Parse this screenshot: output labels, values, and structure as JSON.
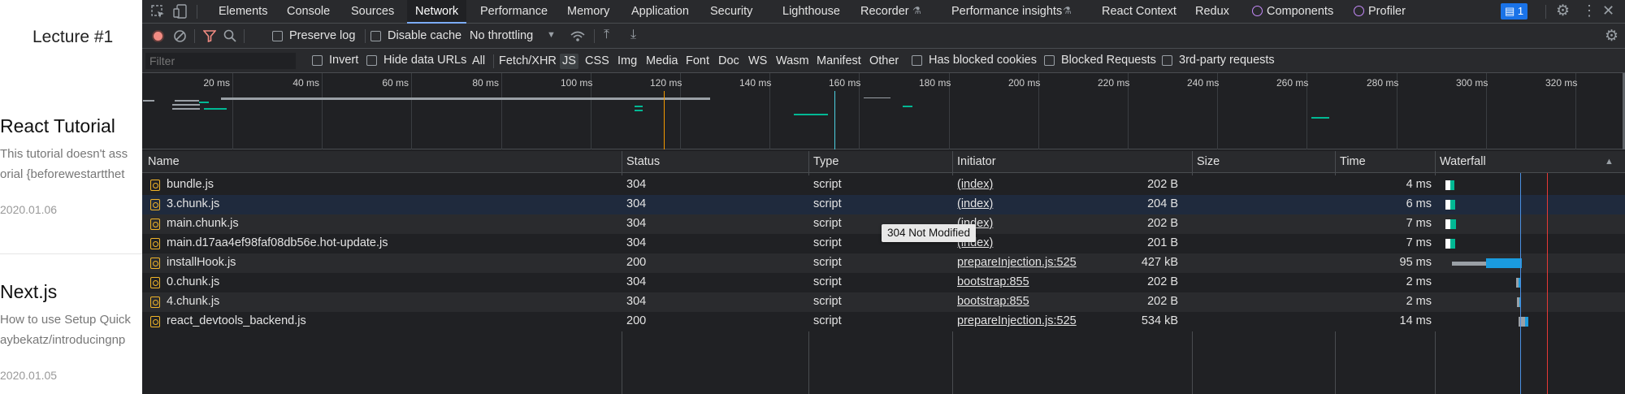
{
  "page": {
    "lecture": "Lecture #1",
    "posts": [
      {
        "title": "React Tutorial",
        "desc1": "This tutorial doesn't ass",
        "desc2": "orial {beforewestartthet",
        "date": "2020.01.06"
      },
      {
        "title": "Next.js",
        "desc1": "How to use Setup Quick",
        "desc2": "aybekatz/introducingnp",
        "date": "2020.01.05"
      }
    ]
  },
  "devtools": {
    "tabs": [
      "Elements",
      "Console",
      "Sources",
      "Network",
      "Performance",
      "Memory",
      "Application",
      "Security",
      "Lighthouse",
      "Recorder",
      "Performance insights",
      "React Context",
      "Redux",
      "Components",
      "Profiler"
    ],
    "active_tab": "Network",
    "issues_badge": "1",
    "toolbar": {
      "preserve_log": "Preserve log",
      "disable_cache": "Disable cache",
      "throttling": "No throttling"
    },
    "filterbar": {
      "placeholder": "Filter",
      "invert": "Invert",
      "hide_data_urls": "Hide data URLs",
      "types": [
        "All",
        "Fetch/XHR",
        "JS",
        "CSS",
        "Img",
        "Media",
        "Font",
        "Doc",
        "WS",
        "Wasm",
        "Manifest",
        "Other"
      ],
      "selected_type": "JS",
      "has_blocked_cookies": "Has blocked cookies",
      "blocked_requests": "Blocked Requests",
      "third_party": "3rd-party requests"
    },
    "timeline_ticks": [
      "20 ms",
      "40 ms",
      "60 ms",
      "80 ms",
      "100 ms",
      "120 ms",
      "140 ms",
      "160 ms",
      "180 ms",
      "200 ms",
      "220 ms",
      "240 ms",
      "260 ms",
      "280 ms",
      "300 ms",
      "320 ms"
    ],
    "columns": [
      "Name",
      "Status",
      "Type",
      "Initiator",
      "Size",
      "Time",
      "Waterfall"
    ],
    "rows": [
      {
        "name": "bundle.js",
        "status": "304",
        "type": "script",
        "initiator": "(index)",
        "size": "202 B",
        "time": "4 ms"
      },
      {
        "name": "3.chunk.js",
        "status": "304",
        "type": "script",
        "initiator": "(index)",
        "size": "204 B",
        "time": "6 ms"
      },
      {
        "name": "main.chunk.js",
        "status": "304",
        "type": "script",
        "initiator": "(index)",
        "size": "202 B",
        "time": "7 ms"
      },
      {
        "name": "main.d17aa4ef98faf08db56e.hot-update.js",
        "status": "304",
        "type": "script",
        "initiator": "(index)",
        "size": "201 B",
        "time": "7 ms"
      },
      {
        "name": "installHook.js",
        "status": "200",
        "type": "script",
        "initiator": "prepareInjection.js:525",
        "size": "427 kB",
        "time": "95 ms"
      },
      {
        "name": "0.chunk.js",
        "status": "304",
        "type": "script",
        "initiator": "bootstrap:855",
        "size": "202 B",
        "time": "2 ms"
      },
      {
        "name": "4.chunk.js",
        "status": "304",
        "type": "script",
        "initiator": "bootstrap:855",
        "size": "202 B",
        "time": "2 ms"
      },
      {
        "name": "react_devtools_backend.js",
        "status": "200",
        "type": "script",
        "initiator": "prepareInjection.js:525",
        "size": "534 kB",
        "time": "14 ms"
      }
    ],
    "tooltip": "304 Not Modified",
    "colors": {
      "accent": "#7cacf8",
      "record": "#f28b82",
      "waiting": "#00b894",
      "download": "#1a9bde",
      "file_icon": "#f0b429"
    }
  }
}
